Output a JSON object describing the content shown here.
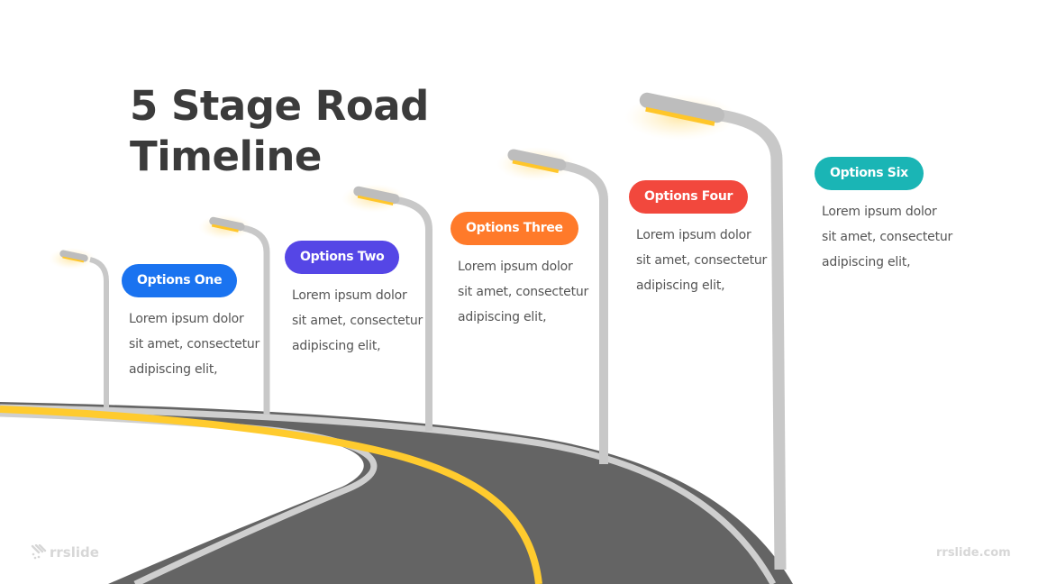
{
  "slide": {
    "title_lines": [
      "5 Stage Road",
      "Timeline"
    ],
    "stages": [
      {
        "label": "Options One",
        "color": "#1a73f0",
        "desc_lines": [
          "Lorem ipsum dolor",
          "sit amet, consectetur",
          "adipiscing elit,"
        ]
      },
      {
        "label": "Options Two",
        "color": "#5546e6",
        "desc_lines": [
          "Lorem ipsum dolor",
          "sit amet, consectetur",
          "adipiscing elit,"
        ]
      },
      {
        "label": "Options Three",
        "color": "#ff7a2a",
        "desc_lines": [
          "Lorem ipsum dolor",
          "sit amet, consectetur",
          "adipiscing elit,"
        ]
      },
      {
        "label": "Options Four",
        "color": "#f2483d",
        "desc_lines": [
          "Lorem ipsum dolor",
          "sit amet, consectetur",
          "adipiscing elit,"
        ]
      },
      {
        "label": "Options Six",
        "color": "#1ab5b5",
        "desc_lines": [
          "Lorem ipsum dolor",
          "sit amet, consectetur",
          "adipiscing elit,"
        ]
      }
    ],
    "colors": {
      "road": "#646464",
      "road_edge": "#cfcfcf",
      "center_line": "#ffcb2e",
      "pole": "#c8c8c8",
      "lamp_light": "#ffc62a"
    },
    "watermark_logo": "rrslide",
    "watermark_url": "rrslide.com"
  }
}
